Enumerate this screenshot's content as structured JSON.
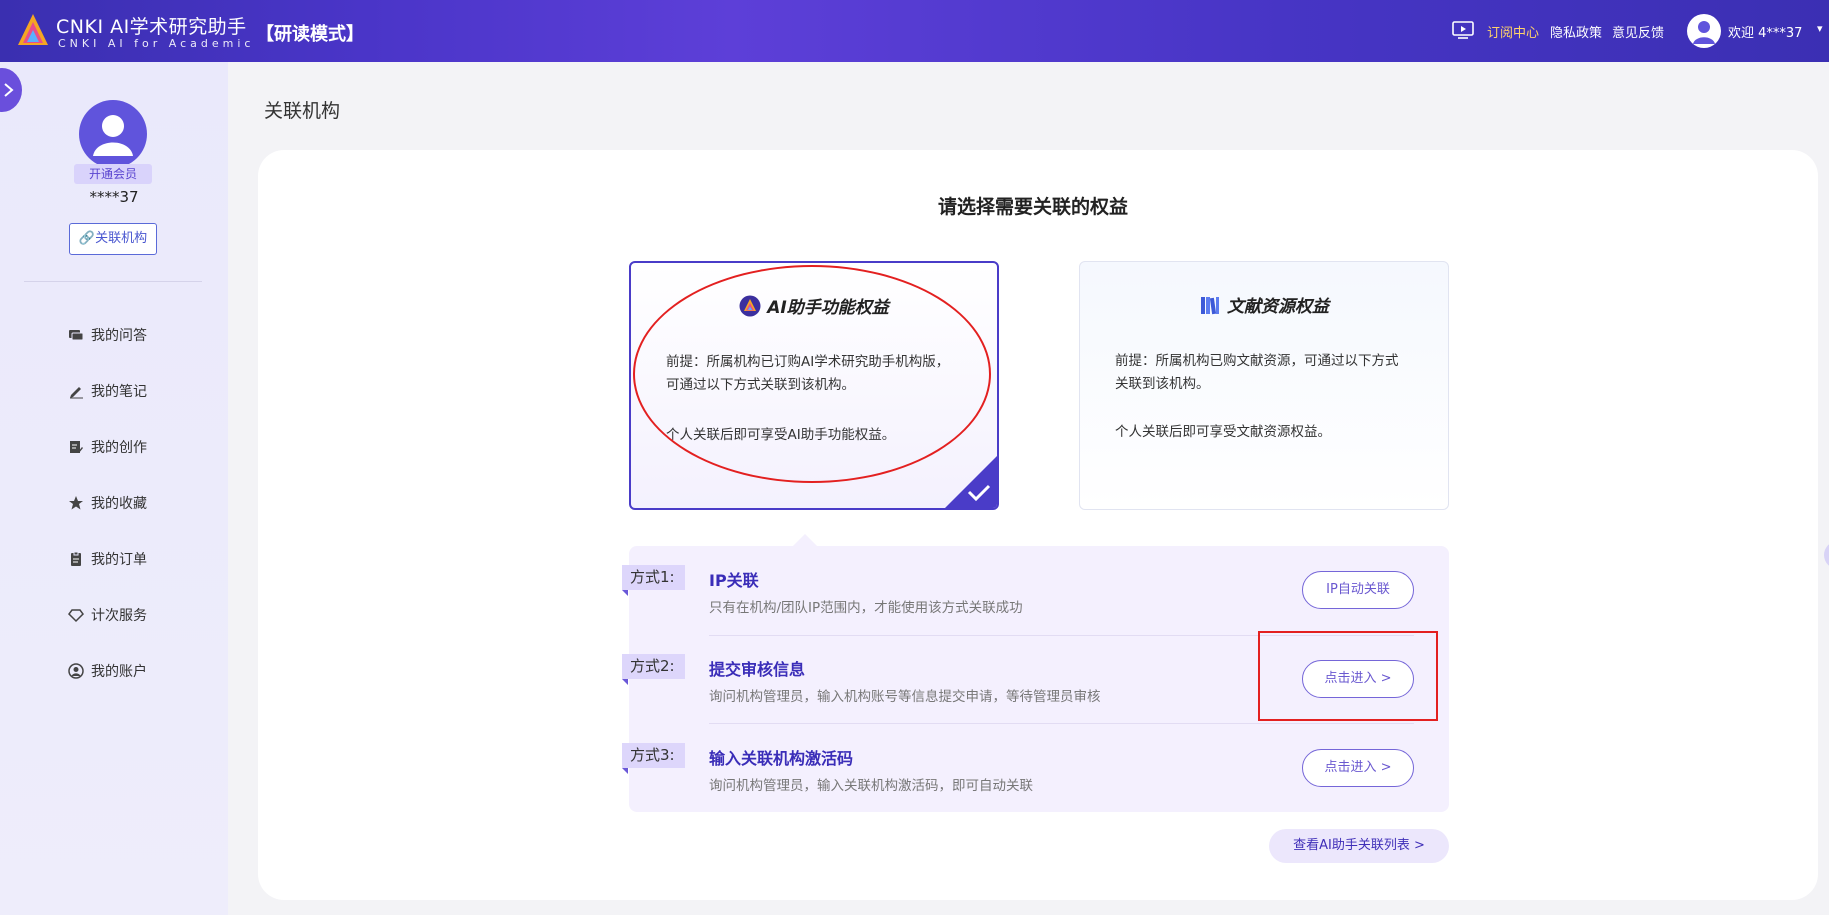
{
  "header": {
    "brand_title": "CNKI AI学术研究助手",
    "brand_subtitle": "CNKI AI for Academic",
    "mode": "【研读模式】",
    "nav": [
      "订阅中心",
      "隐私政策",
      "意见反馈"
    ],
    "welcome": "欢迎 4***37",
    "icons": [
      "cnki-logo-icon",
      "monitor-icon",
      "user-avatar-icon",
      "caret-down-icon"
    ],
    "colors": {
      "bg": "#4a35c8",
      "active_nav": "#ffd36b"
    }
  },
  "sidebar": {
    "vip_badge": "开通会员",
    "user_name": "****37",
    "link_org_button": "关联机构",
    "items": [
      {
        "label": "我的问答",
        "icon": "chat-icon"
      },
      {
        "label": "我的笔记",
        "icon": "pen-icon"
      },
      {
        "label": "我的创作",
        "icon": "edit-doc-icon"
      },
      {
        "label": "我的收藏",
        "icon": "star-icon"
      },
      {
        "label": "我的订单",
        "icon": "clipboard-icon"
      },
      {
        "label": "计次服务",
        "icon": "diamond-icon"
      },
      {
        "label": "我的账户",
        "icon": "account-icon"
      }
    ]
  },
  "main": {
    "page_title": "关联机构",
    "select_title": "请选择需要关联的权益",
    "cards": [
      {
        "title": "AI助手功能权益",
        "premise": "前提：所属机构已订购AI学术研究助手机构版，",
        "premise2": "可通过以下方式关联到该机构。",
        "benefit": "个人关联后即可享受AI助手功能权益。",
        "selected": true
      },
      {
        "title": "文献资源权益",
        "premise": "前提：所属机构已购文献资源，可通过以下方式",
        "premise2": "关联到该机构。",
        "benefit": "个人关联后即可享受文献资源权益。",
        "selected": false
      }
    ],
    "methods": [
      {
        "tag": "方式1:",
        "title": "IP关联",
        "desc": "只有在机构/团队IP范围内，才能使用该方式关联成功",
        "button": "IP自动关联"
      },
      {
        "tag": "方式2:",
        "title": "提交审核信息",
        "desc": "询问机构管理员，输入机构账号等信息提交申请，等待管理员审核",
        "button": "点击进入 >"
      },
      {
        "tag": "方式3:",
        "title": "输入关联机构激活码",
        "desc": "询问机构管理员，输入关联机构激活码，即可自动关联",
        "button": "点击进入 >"
      }
    ],
    "view_list_button": "查看AI助手关联列表 >",
    "colors": {
      "accent": "#4a3cc8",
      "annotation": "#e32020"
    }
  }
}
